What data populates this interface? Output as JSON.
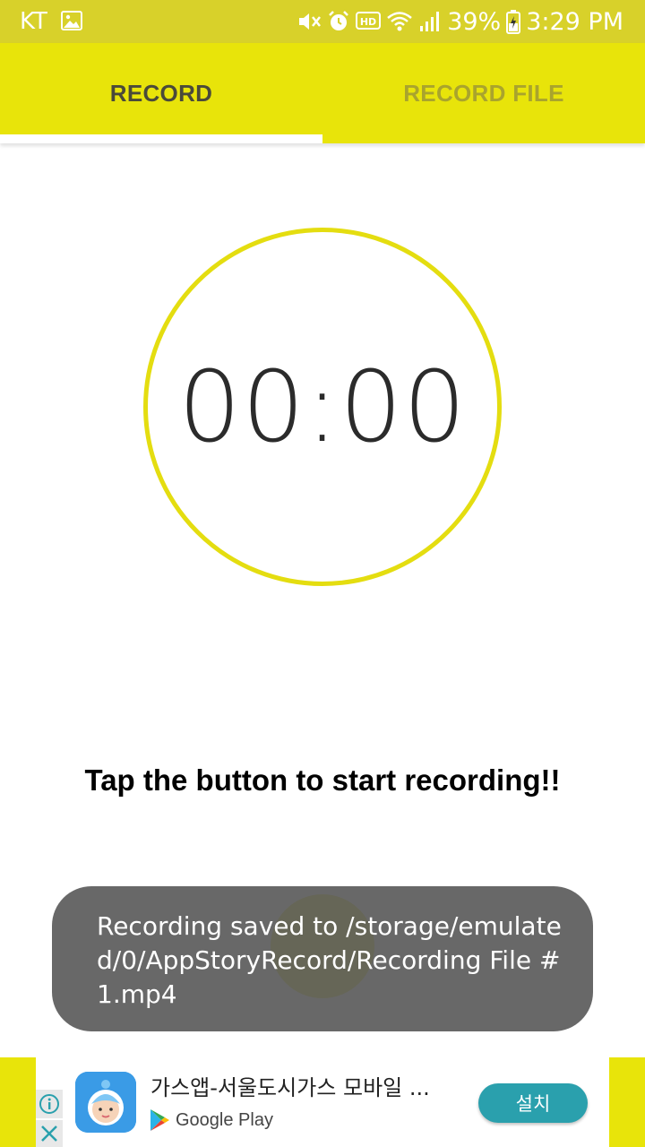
{
  "status_bar": {
    "carrier": "KT",
    "battery_percent": "39%",
    "time": "3:29 PM",
    "icons": [
      "gallery-icon",
      "mute-icon",
      "alarm-icon",
      "hd-icon",
      "wifi-icon",
      "signal-icon",
      "battery-charging-icon"
    ]
  },
  "tabs": [
    {
      "label": "RECORD",
      "selected": true
    },
    {
      "label": "RECORD FILE",
      "selected": false
    }
  ],
  "timer": {
    "value": "00:00"
  },
  "instruction": "Tap the button to start recording!!",
  "toast": {
    "message": "Recording saved to /storage/emulated/0/AppStoryRecord/Recording File #1.mp4"
  },
  "ad": {
    "title": "가스앱-서울도시가스 모바일 ...",
    "store": "Google Play",
    "install_label": "설치"
  },
  "colors": {
    "accent": "#e8e40a",
    "status_bar": "#d8d12a",
    "ring": "#e4dd10",
    "toast": "#5c5c5c",
    "install_button": "#2aa0ad"
  }
}
